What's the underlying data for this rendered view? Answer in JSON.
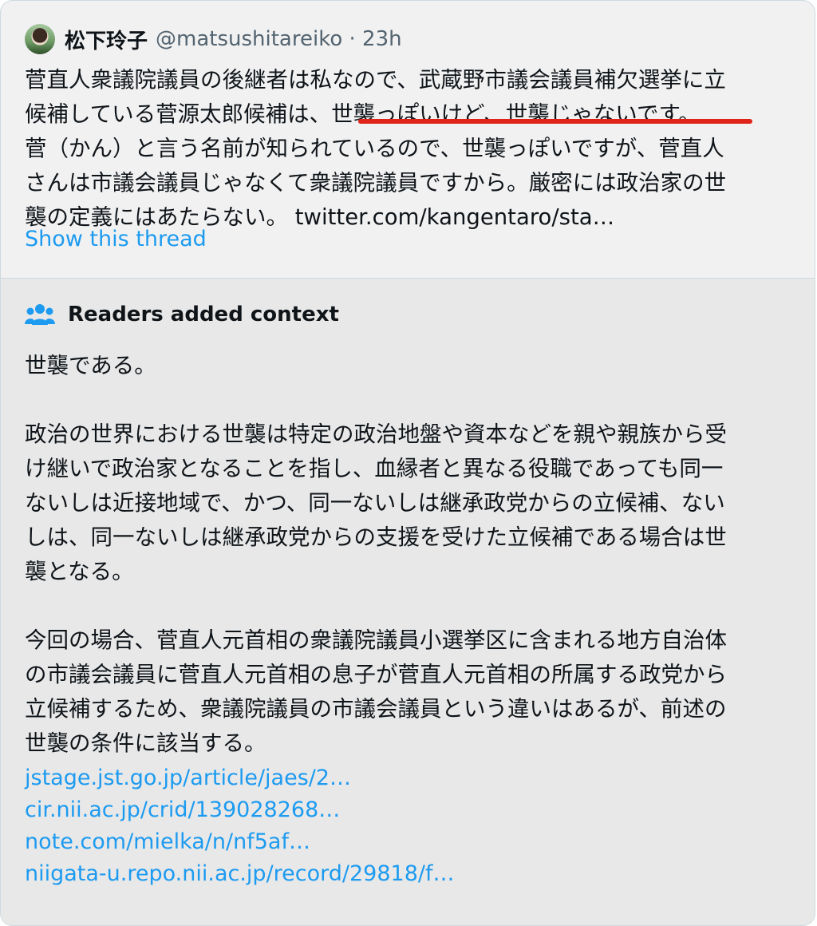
{
  "tweet": {
    "author_name": "松下玲子",
    "handle_time": "@matsushitareiko · 23h",
    "lines": [
      "菅直人衆議院議員の後継者は私なので、武蔵野市議会議員補欠選挙に立",
      "候補している菅源太郎候補は、世襲っぽいけど、世襲じゃないです。",
      "菅（かん）と言う名前が知られているので、世襲っぽいですが、菅直人",
      "さんは市議会議員じゃなくて衆議院議員ですから。厳密には政治家の世",
      "襲の定義にはあたらない。 twitter.com/kangentaro/sta…"
    ],
    "show_thread": "Show this thread"
  },
  "context": {
    "title": "Readers added context",
    "paragraphs": [
      [
        "世襲である。"
      ],
      [
        "政治の世界における世襲は特定の政治地盤や資本などを親や親族から受",
        "け継いで政治家となることを指し、血縁者と異なる役職であっても同一",
        "ないしは近接地域で、かつ、同一ないしは継承政党からの立候補、ない",
        "しは、同一ないしは継承政党からの支援を受けた立候補である場合は世",
        "襲となる。"
      ],
      [
        "今回の場合、菅直人元首相の衆議院議員小選挙区に含まれる地方自治体",
        "の市議会議員に菅直人元首相の息子が菅直人元首相の所属する政党から",
        "立候補するため、衆議院議員の市議会議員という違いはあるが、前述の",
        "世襲の条件に該当する。"
      ]
    ],
    "links": [
      "jstage.jst.go.jp/article/jaes/2…",
      "cir.nii.ac.jp/crid/139028268…",
      "note.com/mielka/n/nf5af…",
      "niigata-u.repo.nii.ac.jp/record/29818/f…"
    ]
  },
  "colors": {
    "accent": "#1d9bf0",
    "underline": "#e0241a",
    "text": "#0f1419",
    "muted": "#536471"
  }
}
